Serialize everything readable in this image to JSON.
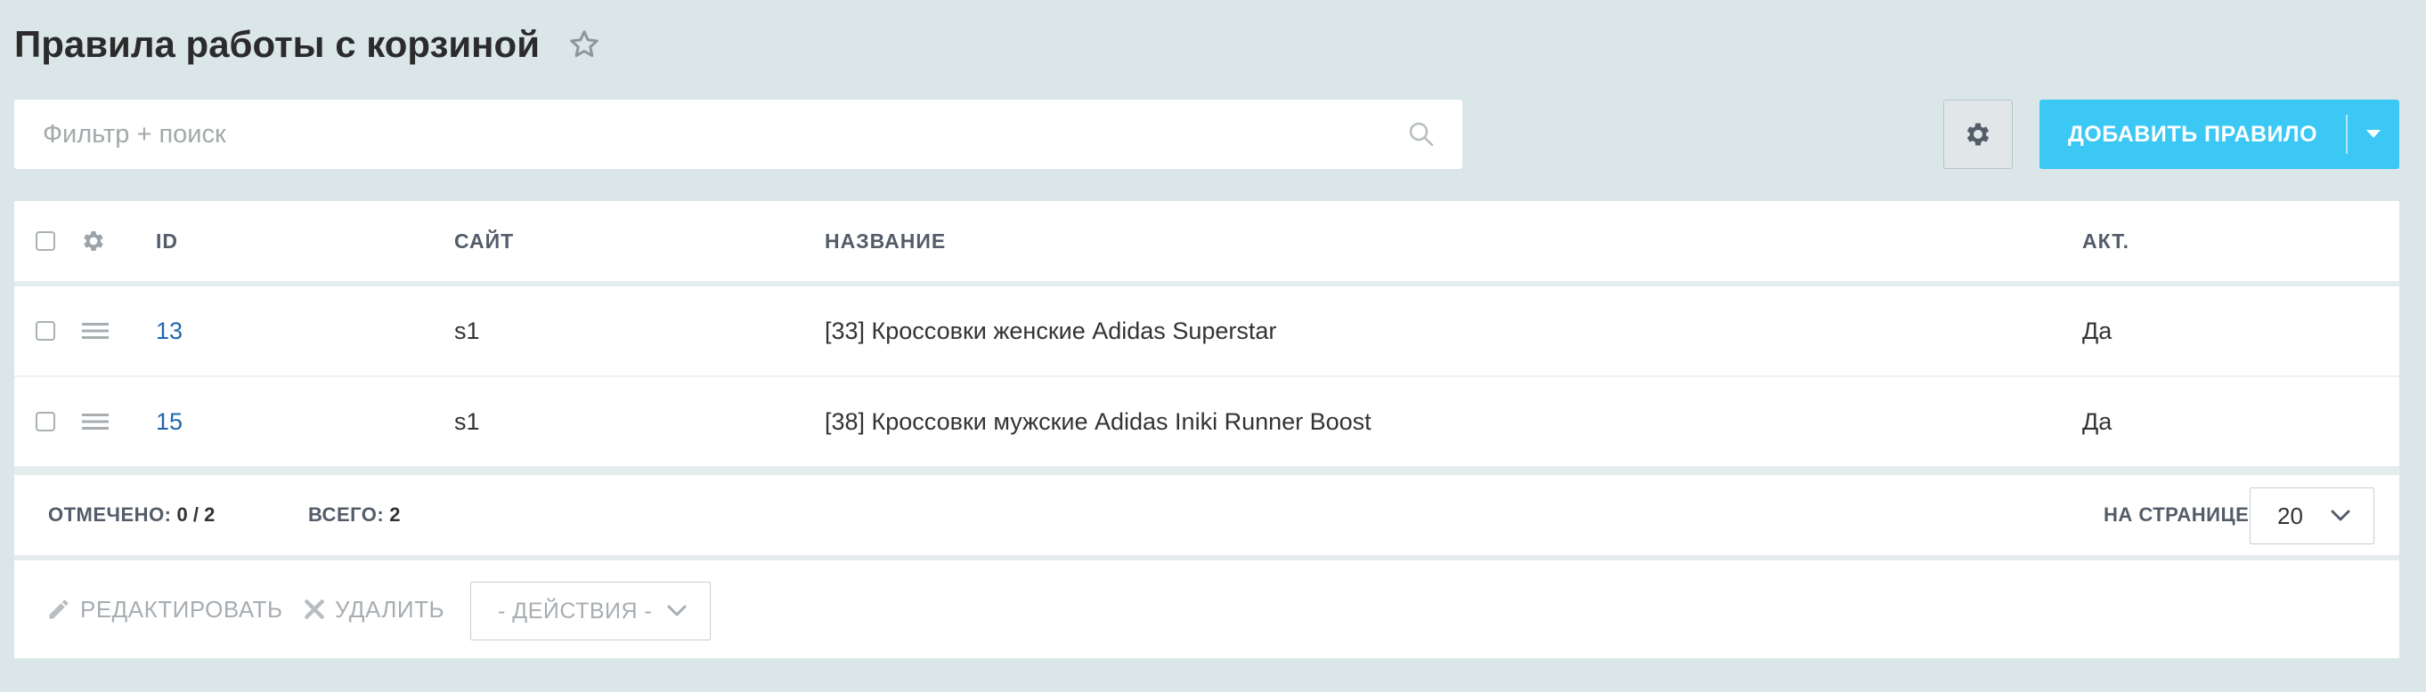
{
  "page": {
    "title": "Правила работы с корзиной"
  },
  "search": {
    "placeholder": "Фильтр + поиск"
  },
  "toolbar": {
    "add_label": "ДОБАВИТЬ ПРАВИЛО"
  },
  "table": {
    "headers": {
      "id": "ID",
      "site": "САЙТ",
      "name": "НАЗВАНИЕ",
      "active": "АКТ."
    },
    "rows": [
      {
        "id": "13",
        "site": "s1",
        "name": "[33] Кроссовки женские Adidas Superstar",
        "active": "Да"
      },
      {
        "id": "15",
        "site": "s1",
        "name": "[38] Кроссовки мужские Adidas Iniki Runner Boost",
        "active": "Да"
      }
    ]
  },
  "footer": {
    "selected_label": "ОТМЕЧЕНО:",
    "selected_value": "0 / 2",
    "total_label": "ВСЕГО:",
    "total_value": "2",
    "per_page_label": "НА СТРАНИЦЕ:",
    "per_page_value": "20"
  },
  "actions": {
    "edit_label": "РЕДАКТИРОВАТЬ",
    "delete_label": "УДАЛИТЬ",
    "more_label": "- ДЕЙСТВИЯ -"
  },
  "colors": {
    "background": "#dbe6e8",
    "accent": "#3bc8f5",
    "link": "#2067b0"
  },
  "icons": {
    "favorite": "star-icon",
    "search": "search-icon",
    "settings": "gear-icon",
    "row_menu": "hamburger-icon",
    "edit": "pencil-icon",
    "delete": "close-icon",
    "dropdown": "chevron-down-icon"
  }
}
